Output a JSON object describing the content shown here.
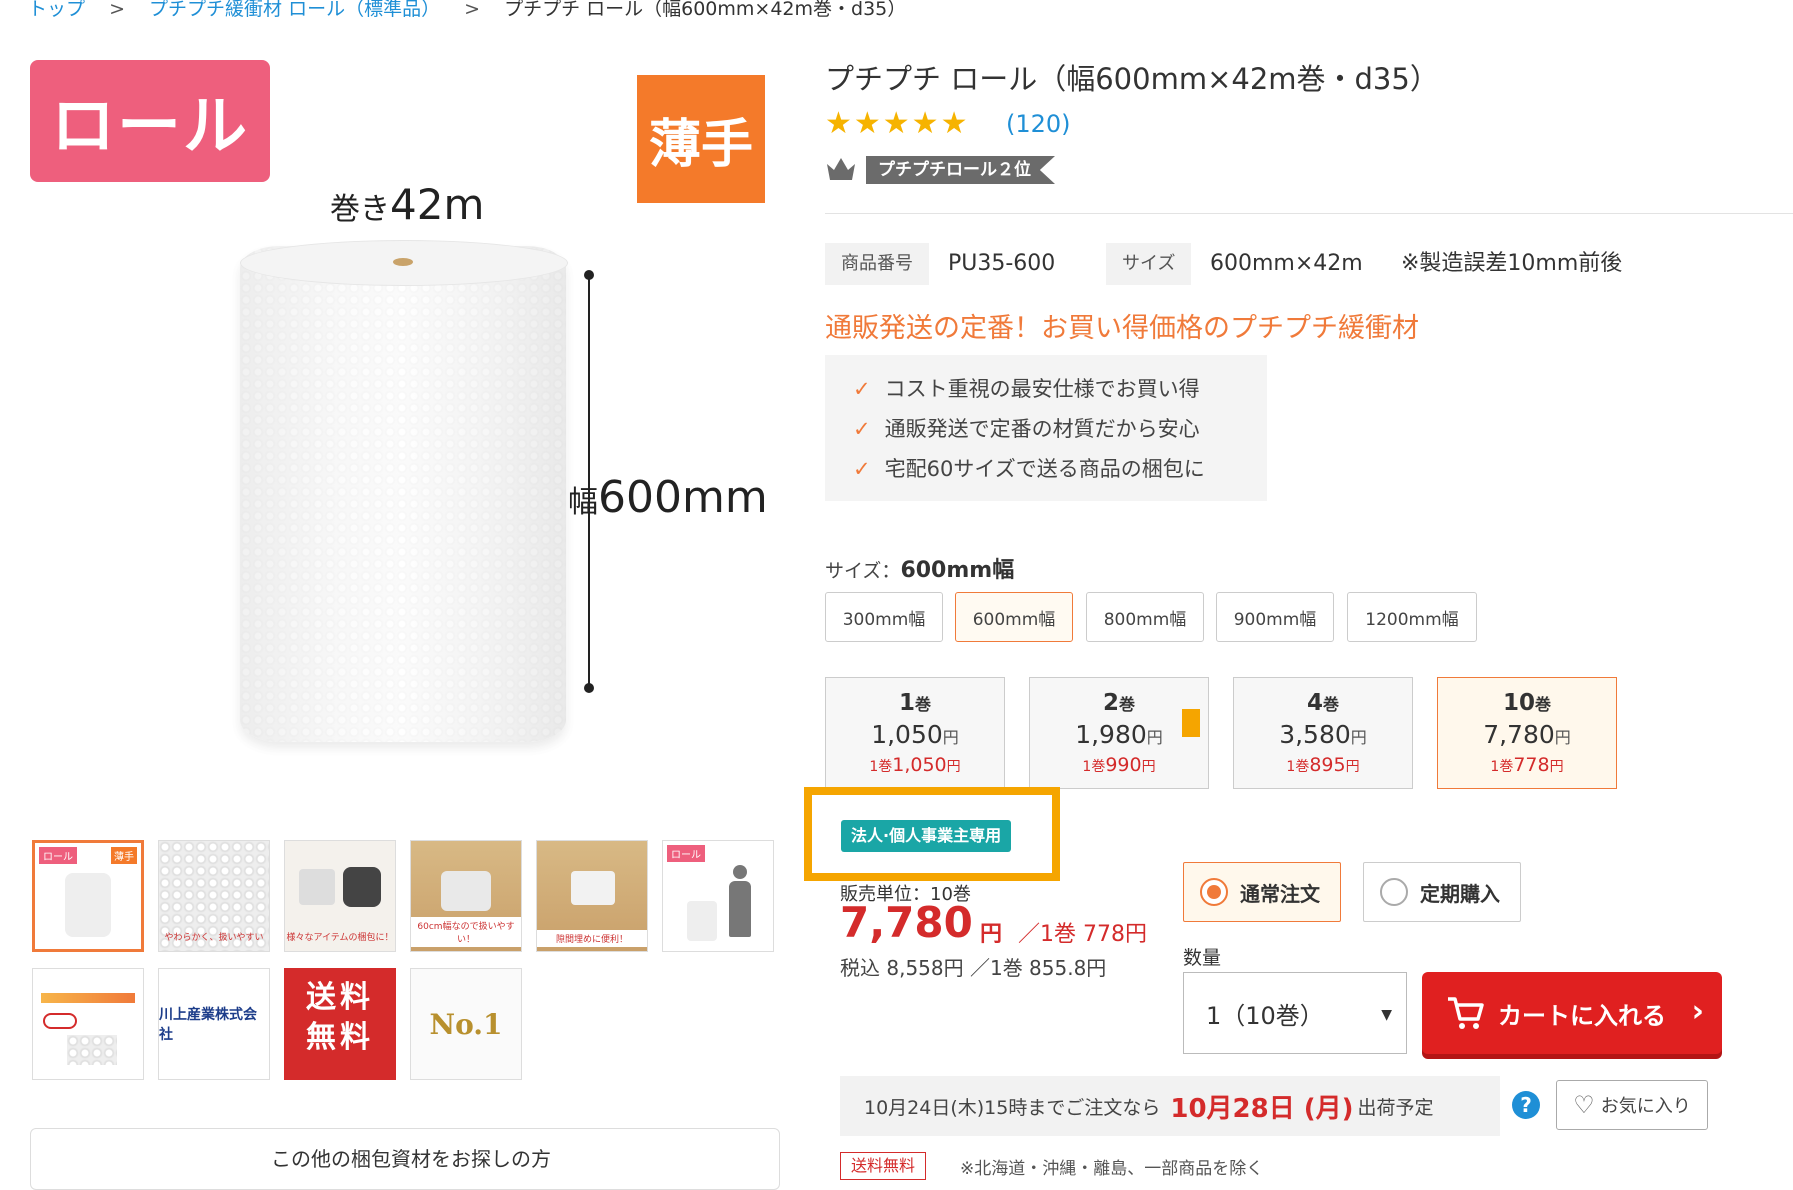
{
  "breadcrumb": {
    "items": [
      "トップ",
      "プチプチ緩衝材 ロール（標準品）",
      "プチプチ ロール（幅600mm×42m巻・d35）"
    ],
    "separator": ">"
  },
  "gallery": {
    "badge_roll": "ロール",
    "badge_thin": "薄手",
    "length_prefix": "巻き",
    "length_value": "42m",
    "width_prefix": "幅",
    "width_value": "600mm",
    "thumbnails": [
      {
        "caption": ""
      },
      {
        "caption": "やわらかく、扱いやすい"
      },
      {
        "caption": "様々なアイテムの梱包に！"
      },
      {
        "caption": "60cm幅なので扱いやすい！"
      },
      {
        "caption": "隙間埋めに便利！"
      },
      {
        "caption": ""
      },
      {
        "caption": ""
      },
      {
        "caption": "川上産業株式会社"
      },
      {
        "caption": "送料無料"
      },
      {
        "caption": "No.1"
      }
    ],
    "other_materials": "この他の梱包資材をお探しの方"
  },
  "product": {
    "title": "プチプチ ロール（幅600mm×42m巻・d35）",
    "stars": "★★★★★",
    "review_count": "(120)",
    "rank": "プチプチロール２位",
    "sku_label": "商品番号",
    "sku_value": "PU35-600",
    "size_label": "サイズ",
    "size_value": "600mm×42m",
    "size_note": "※製造誤差10mm前後",
    "headline": "通販発送の定番！お買い得価格のプチプチ緩衝材",
    "features": [
      "コスト重視の最安仕様でお買い得",
      "通販発送で定番の材質だから安心",
      "宅配60サイズで送る商品の梱包に"
    ],
    "checkmark": "✓"
  },
  "size_selector": {
    "label": "サイズ：",
    "selected": "600mm幅",
    "options": [
      "300mm幅",
      "600mm幅",
      "800mm幅",
      "900mm幅",
      "1200mm幅"
    ]
  },
  "quantity_cards": [
    {
      "qty": "1",
      "unit": "巻",
      "price": "1,050",
      "yen": "円",
      "per_unit_prefix": "1巻",
      "per_unit": "1,050",
      "per_yen": "円"
    },
    {
      "qty": "2",
      "unit": "巻",
      "price": "1,980",
      "yen": "円",
      "per_unit_prefix": "1巻",
      "per_unit": "990",
      "per_yen": "円"
    },
    {
      "qty": "4",
      "unit": "巻",
      "price": "3,580",
      "yen": "円",
      "per_unit_prefix": "1巻",
      "per_unit": "895",
      "per_yen": "円"
    },
    {
      "qty": "10",
      "unit": "巻",
      "price": "7,780",
      "yen": "円",
      "per_unit_prefix": "1巻",
      "per_unit": "778",
      "per_yen": "円"
    }
  ],
  "pricing": {
    "corporate_badge": "法人·個人事業主専用",
    "unit_label": "販売単位：10巻",
    "price": "7,780",
    "yen": "円",
    "per_unit": "／1巻 778円",
    "tax_included": "税込 8,558円 ／1巻 855.8円"
  },
  "order": {
    "normal": "通常注文",
    "subscription": "定期購入",
    "quantity_label": "数量",
    "quantity_value": "1（10巻）",
    "cart_button": "カートに入れる"
  },
  "shipping": {
    "prefix": "10月24日(木)15時までご注文なら",
    "date": "10月28日 (月)",
    "suffix": "出荷予定",
    "help": "?",
    "favorite": "お気に入り",
    "free_tag": "送料無料",
    "free_note": "※北海道・沖縄・離島、一部商品を除く"
  },
  "colors": {
    "accent": "#f07a3a",
    "price_red": "#d42b2b",
    "link": "#1f8fd6",
    "highlight": "#f5a500",
    "corp_badge": "#1aa6a6"
  }
}
